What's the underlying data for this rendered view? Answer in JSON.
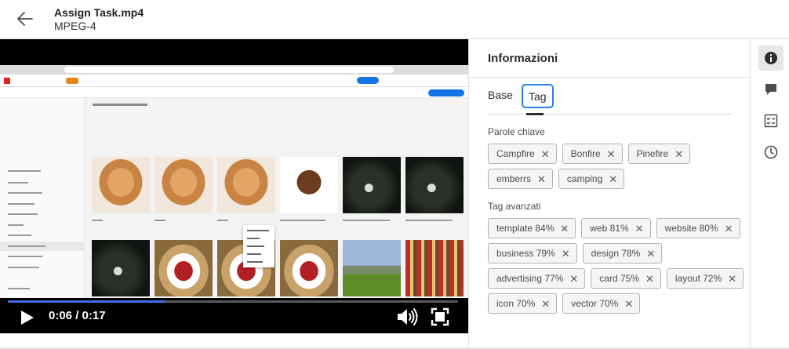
{
  "header": {
    "title": "Assign Task.mp4",
    "subtitle": "MPEG-4"
  },
  "player": {
    "current_time": "0:06",
    "separator": "/",
    "duration": "0:17",
    "progress": 0.35,
    "accent_color": "#3f6ff0"
  },
  "panel": {
    "title": "Informazioni",
    "tabs": [
      {
        "label": "Base",
        "selected": false
      },
      {
        "label": "Tag",
        "selected": true
      }
    ],
    "keywords_label": "Parole chiave",
    "keywords": [
      [
        "Campfire",
        "Bonfire",
        "Pinefire"
      ],
      [
        "emberrs",
        "camping"
      ]
    ],
    "smart_tags_label": "Tag avanzati",
    "smart_tags": [
      [
        "template 84%",
        "web 81%",
        "website 80%"
      ],
      [
        "business 79%",
        "design 78%"
      ],
      [
        "advertising 77%",
        "card 75%",
        "layout 72%"
      ],
      [
        "icon 70%",
        "vector 70%"
      ]
    ],
    "remove_glyph": "✕",
    "focus_color": "#2680eb"
  },
  "sidebar_icons": [
    "info-icon",
    "comment-icon",
    "tasks-icon",
    "history-icon"
  ]
}
